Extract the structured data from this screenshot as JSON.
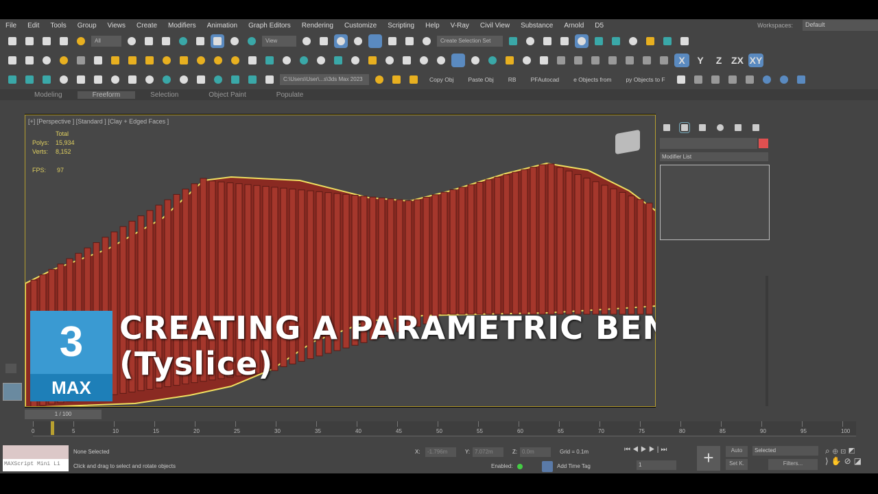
{
  "menu": [
    "File",
    "Edit",
    "Tools",
    "Group",
    "Views",
    "Create",
    "Modifiers",
    "Animation",
    "Graph Editors",
    "Rendering",
    "Customize",
    "Scripting",
    "Help",
    "V-Ray",
    "Civil View",
    "Substance",
    "Arnold",
    "D5"
  ],
  "workspaces": {
    "label": "Workspaces:",
    "value": "Default"
  },
  "toolbar1": {
    "filter": "All",
    "refcoord": "View",
    "selset": "Create Selection Set"
  },
  "toolbar3": {
    "path": "C:\\Users\\User\\...s\\3ds Max 2023",
    "copy": "Copy Obj",
    "paste": "Paste Obj",
    "rb": "RB",
    "pfautocad": "PFAutocad",
    "objfrom": "e Objects from",
    "objto": "py Objects to F"
  },
  "axes": [
    "X",
    "Y",
    "Z",
    "ZX",
    "XY"
  ],
  "ribbon": [
    "Modeling",
    "Freeform",
    "Selection",
    "Object Paint",
    "Populate"
  ],
  "viewport": {
    "label": "[+] [Perspective ] [Standard ] [Clay + Edged Faces ]",
    "total": "Total",
    "polys_label": "Polys:",
    "polys": "15,934",
    "verts_label": "Verts:",
    "verts": "8,152",
    "fps_label": "FPS:",
    "fps": "97"
  },
  "overlay": {
    "title1": "CREATING A PARAMETRIC BENCH",
    "title2": "(Tyslice)",
    "logo_num": "3",
    "logo_text": "MAX"
  },
  "command": {
    "modifier_list": "Modifier List",
    "color": "#e05050"
  },
  "timeline": {
    "frame": "1 / 100",
    "ticks": [
      "0",
      "5",
      "10",
      "15",
      "20",
      "25",
      "30",
      "35",
      "40",
      "45",
      "50",
      "55",
      "60",
      "65",
      "70",
      "75",
      "80",
      "85",
      "90",
      "95",
      "100"
    ],
    "current": 1,
    "max": 100
  },
  "status": {
    "selected": "None Selected",
    "prompt": "Click and drag to select and rotate objects",
    "maxscript": "MAXScript Mini Li",
    "x_label": "X:",
    "x": "-1.796m",
    "y_label": "Y:",
    "y": "7.072m",
    "z_label": "Z:",
    "z": "0.0m",
    "grid": "Grid = 0.1m",
    "enabled": "Enabled:",
    "timetag": "Add Time Tag",
    "frame": "1",
    "auto": "Auto",
    "setk": "Set K.",
    "selected_dd": "Selected",
    "filters": "Filters..."
  }
}
